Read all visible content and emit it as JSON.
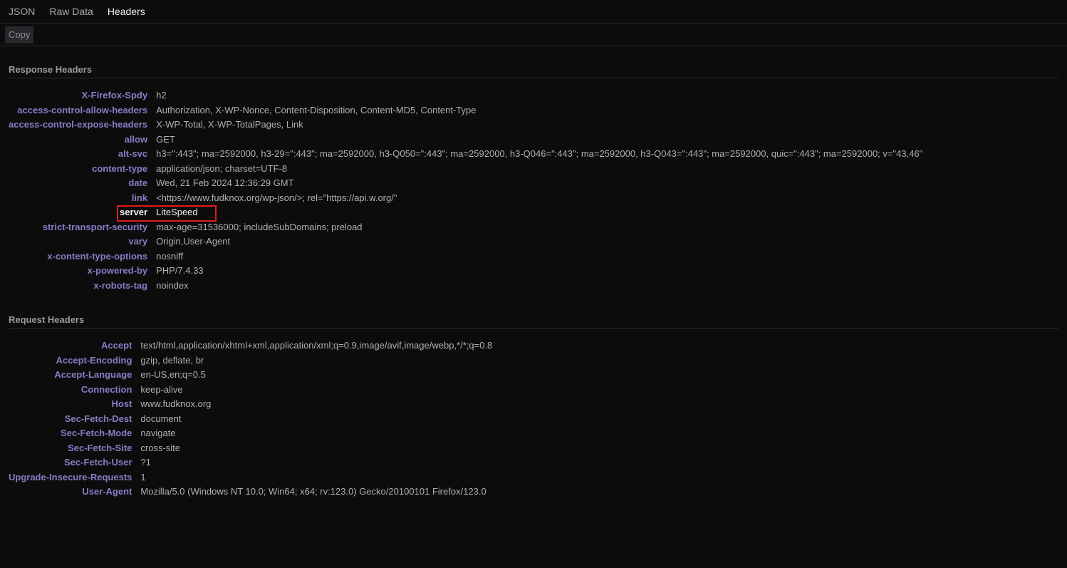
{
  "tabs": [
    {
      "label": "JSON"
    },
    {
      "label": "Raw Data"
    },
    {
      "label": "Headers"
    }
  ],
  "toolbar": {
    "copy_label": "Copy"
  },
  "response": {
    "title": "Response Headers",
    "rows": [
      {
        "name": "X-Firefox-Spdy",
        "value": "h2"
      },
      {
        "name": "access-control-allow-headers",
        "value": "Authorization, X-WP-Nonce, Content-Disposition, Content-MD5, Content-Type"
      },
      {
        "name": "access-control-expose-headers",
        "value": "X-WP-Total, X-WP-TotalPages, Link"
      },
      {
        "name": "allow",
        "value": "GET"
      },
      {
        "name": "alt-svc",
        "value": "h3=\":443\"; ma=2592000, h3-29=\":443\"; ma=2592000, h3-Q050=\":443\"; ma=2592000, h3-Q046=\":443\"; ma=2592000, h3-Q043=\":443\"; ma=2592000, quic=\":443\"; ma=2592000; v=\"43,46\""
      },
      {
        "name": "content-type",
        "value": "application/json; charset=UTF-8"
      },
      {
        "name": "date",
        "value": "Wed, 21 Feb 2024 12:36:29 GMT"
      },
      {
        "name": "link",
        "value": "<https://www.fudknox.org/wp-json/>; rel=\"https://api.w.org/\""
      },
      {
        "name": "server",
        "value": "LiteSpeed"
      },
      {
        "name": "strict-transport-security",
        "value": "max-age=31536000; includeSubDomains; preload"
      },
      {
        "name": "vary",
        "value": "Origin,User-Agent"
      },
      {
        "name": "x-content-type-options",
        "value": "nosniff"
      },
      {
        "name": "x-powered-by",
        "value": "PHP/7.4.33"
      },
      {
        "name": "x-robots-tag",
        "value": "noindex"
      }
    ]
  },
  "request": {
    "title": "Request Headers",
    "rows": [
      {
        "name": "Accept",
        "value": "text/html,application/xhtml+xml,application/xml;q=0.9,image/avif,image/webp,*/*;q=0.8"
      },
      {
        "name": "Accept-Encoding",
        "value": "gzip, deflate, br"
      },
      {
        "name": "Accept-Language",
        "value": "en-US,en;q=0.5"
      },
      {
        "name": "Connection",
        "value": "keep-alive"
      },
      {
        "name": "Host",
        "value": "www.fudknox.org"
      },
      {
        "name": "Sec-Fetch-Dest",
        "value": "document"
      },
      {
        "name": "Sec-Fetch-Mode",
        "value": "navigate"
      },
      {
        "name": "Sec-Fetch-Site",
        "value": "cross-site"
      },
      {
        "name": "Sec-Fetch-User",
        "value": "?1"
      },
      {
        "name": "Upgrade-Insecure-Requests",
        "value": "1"
      },
      {
        "name": "User-Agent",
        "value": "Mozilla/5.0 (Windows NT 10.0; Win64; x64; rv:123.0) Gecko/20100101 Firefox/123.0"
      }
    ]
  }
}
